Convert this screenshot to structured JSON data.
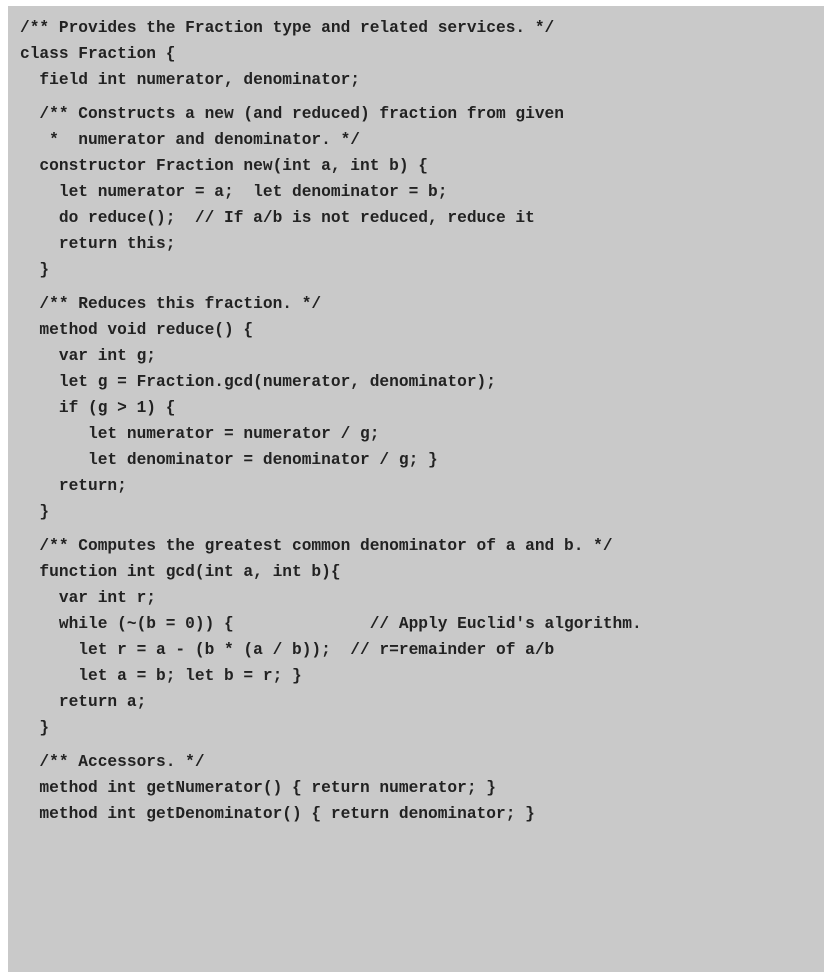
{
  "code": {
    "lines": [
      "/** Provides the Fraction type and related services. */",
      "class Fraction {",
      "  field int numerator, denominator;",
      "  /** Constructs a new (and reduced) fraction from given",
      "   *  numerator and denominator. */",
      "  constructor Fraction new(int a, int b) {",
      "    let numerator = a;  let denominator = b;",
      "    do reduce();  // If a/b is not reduced, reduce it",
      "    return this;",
      "  }",
      "  /** Reduces this fraction. */",
      "  method void reduce() {",
      "    var int g;",
      "    let g = Fraction.gcd(numerator, denominator);",
      "    if (g > 1) {",
      "       let numerator = numerator / g;",
      "       let denominator = denominator / g; }",
      "    return;",
      "  }",
      "  /** Computes the greatest common denominator of a and b. */",
      "  function int gcd(int a, int b){",
      "    var int r;",
      "    while (~(b = 0)) {              // Apply Euclid's algorithm.",
      "      let r = a - (b * (a / b));  // r=remainder of a/b",
      "      let a = b; let b = r; }",
      "    return a;",
      "  }",
      "  /** Accessors. */",
      "  method int getNumerator() { return numerator; }",
      "  method int getDenominator() { return denominator; }"
    ]
  }
}
